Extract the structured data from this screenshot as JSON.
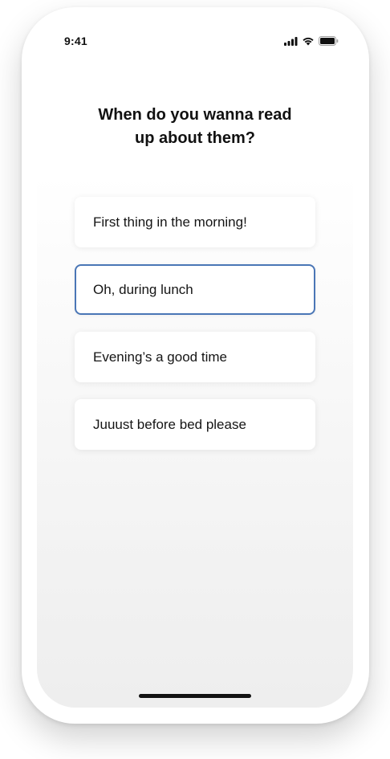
{
  "status_bar": {
    "time": "9:41",
    "icons": [
      "cellular-signal-icon",
      "wifi-icon",
      "battery-icon"
    ]
  },
  "question": {
    "title": "When do you wanna read\nup about them?"
  },
  "options": [
    {
      "label": "First thing in the morning!",
      "selected": false
    },
    {
      "label": "Oh, during lunch",
      "selected": true
    },
    {
      "label": "Evening’s a good time",
      "selected": false
    },
    {
      "label": "Juuust before bed please",
      "selected": false
    }
  ],
  "colors": {
    "selected_border": "#4a76b6",
    "text": "#111111",
    "card_background": "#ffffff"
  }
}
